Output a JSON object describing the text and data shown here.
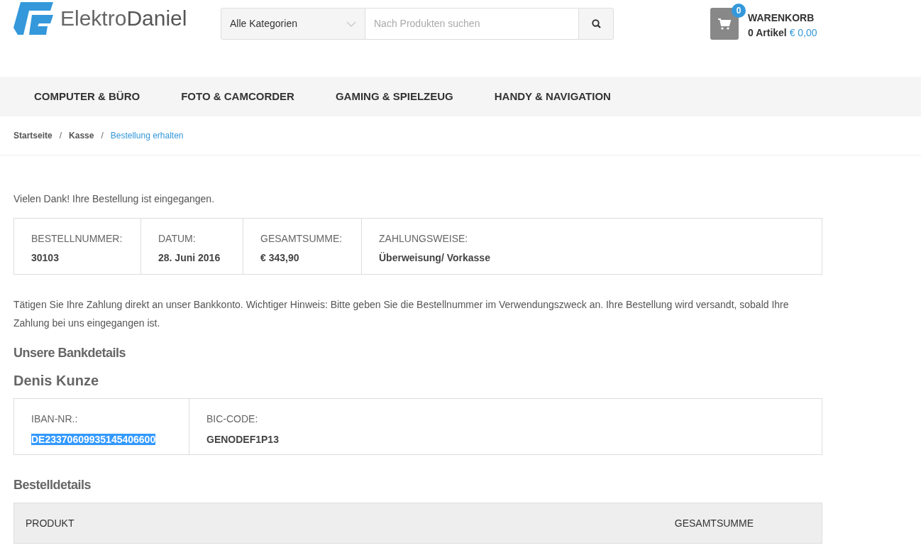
{
  "header": {
    "logo": {
      "first": "Elektro",
      "second": "Daniel"
    },
    "search": {
      "category": "Alle Kategorien",
      "placeholder": "Nach Produkten suchen"
    },
    "cart": {
      "count": "0",
      "title": "WARENKORB",
      "items": "0 Artikel",
      "total": "€ 0,00"
    }
  },
  "nav": [
    "COMPUTER & BÜRO",
    "FOTO & CAMCORDER",
    "GAMING & SPIELZEUG",
    "HANDY & NAVIGATION"
  ],
  "breadcrumb_separator": "/",
  "breadcrumb": [
    {
      "label": "Startseite",
      "current": false
    },
    {
      "label": "Kasse",
      "current": false
    },
    {
      "label": "Bestellung erhalten",
      "current": true
    }
  ],
  "thanks": "Vielen Dank! Ihre Bestellung ist eingegangen.",
  "overview": [
    {
      "label": "BESTELLNUMMER:",
      "value": "30103"
    },
    {
      "label": "DATUM:",
      "value": "28. Juni 2016"
    },
    {
      "label": "GESAMTSUMME:",
      "value": "€ 343,90"
    },
    {
      "label": "ZAHLUNGSWEISE:",
      "value": "Überweisung/ Vorkasse"
    }
  ],
  "payment_note": "Tätigen Sie Ihre Zahlung direkt an unser Bankkonto. Wichtiger Hinweis: Bitte geben Sie die Bestellnummer im Verwendungszweck an. Ihre Bestellung wird versandt, sobald Ihre Zahlung bei uns eingegangen ist.",
  "bank": {
    "heading": "Unsere Bankdetails",
    "holder": "Denis Kunze",
    "fields": [
      {
        "label": "IBAN-NR.:",
        "value": "DE23370609935145406600",
        "highlighted": true
      },
      {
        "label": "BIC-CODE:",
        "value": "GENODEF1P13",
        "highlighted": false
      }
    ]
  },
  "order_details": {
    "heading": "Bestelldetails",
    "columns": [
      "PRODUKT",
      "GESAMTSUMME"
    ]
  }
}
